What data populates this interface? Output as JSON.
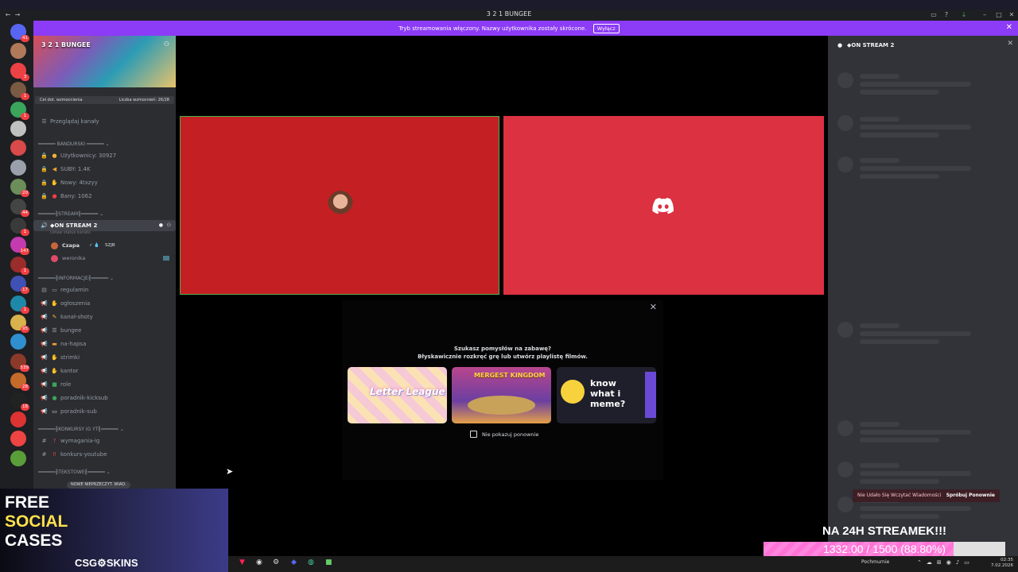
{
  "window": {
    "title": "3 2 1 BUNGEE"
  },
  "banner": {
    "text": "Tryb streamowania włączony. Nazwy użytkownika zostały skrócone.",
    "button": "Wyłącz"
  },
  "servers": [
    {
      "badge": "41",
      "color": "#5865f2"
    },
    {
      "badge": "",
      "color": "#b07a5a"
    },
    {
      "badge": "3",
      "color": "#ed4245"
    },
    {
      "badge": "1",
      "color": "#7a5a42"
    },
    {
      "badge": "1",
      "color": "#3ba55c"
    },
    {
      "badge": "",
      "color": "#c0c0c0"
    },
    {
      "badge": "",
      "color": "#d94a4a"
    },
    {
      "badge": "",
      "color": "#9aa1ad"
    },
    {
      "badge": "20",
      "color": "#6b8e5a"
    },
    {
      "badge": "44",
      "color": "#444"
    },
    {
      "badge": "1",
      "color": "#3a3a3a"
    },
    {
      "badge": "147",
      "color": "#c43bb0"
    },
    {
      "badge": "1",
      "color": "#9b2c2c"
    },
    {
      "badge": "17",
      "color": "#3f51b5"
    },
    {
      "badge": "1",
      "color": "#1e88a8"
    },
    {
      "badge": "95",
      "color": "#d8b24a"
    },
    {
      "badge": "",
      "color": "#2f8fcf"
    },
    {
      "badge": "539",
      "color": "#8b3a2a"
    },
    {
      "badge": "28",
      "color": "#c46a2a"
    },
    {
      "badge": "18",
      "color": "#222"
    },
    {
      "badge": "",
      "color": "#d33"
    },
    {
      "badge": "",
      "color": "#e44"
    },
    {
      "badge": "",
      "color": "#5a9e3a"
    }
  ],
  "guild": {
    "name": "3 2 1 BUNGEE",
    "boost_goal": "Cel dot. wzmocnienia",
    "boost_count": "Liczba wzmocnień: 26/28",
    "browse": "Przeglądaj kanały"
  },
  "sidebar": {
    "cat_bandurski": "BANDURSKI",
    "stat_users": "Użytkownicy: 30927",
    "stat_subs": "SUBY: 1.4K",
    "stat_new": "Nowy: 4txzyy",
    "stat_bans": "Bany: 1062",
    "cat_stream": "STREAM",
    "voice_channel": "◆ON STREAM 2",
    "voice_status": "Ustaw status kanału",
    "user1": "Czapa",
    "user1_tag": "SZJB",
    "user2": "weronika",
    "cat_info": "INFORMACJE",
    "ch_regulamin": "regulamin",
    "ch_ogloszenia": "ogłoszenia",
    "ch_kanal_shoty": "kanał-shoty",
    "ch_bungee": "bungee",
    "ch_na_hapsa": "na-hapsa",
    "ch_strimki": "strimki",
    "ch_kantor": "kantor",
    "ch_role": "role",
    "ch_poradnik_kicksub": "poradnik-kicksub",
    "ch_poradnik_sub": "poradnik-sub",
    "cat_konkursy": "KONKURSY IG YT",
    "ch_wymagania": "wymagania-ig",
    "ch_konkurs_youtube": "konkurs-youtube",
    "cat_tekstowe": "TEKSTOWE",
    "new_unread": "NOWE NIEPRZECZYT. WIAD."
  },
  "popup": {
    "title1": "Szukasz pomysłów na zabawę?",
    "title2": "Błyskawicznie rozkręć grę lub utwórz playlistę filmów.",
    "card1": "Letter League",
    "card2": "MERGEST KINGDOM",
    "card3": "know what i meme?",
    "checkbox": "Nie pokazuj ponownie"
  },
  "chat": {
    "header": "◆ON STREAM 2",
    "error": "Nie Udało Się Wczytać Wiadomości",
    "retry": "Spróbuj Ponownie"
  },
  "overlay": {
    "ad_line1": "FREE",
    "ad_line2": "SOCIAL",
    "ad_line3": "CASES",
    "ad_brand": "CSG⚙SKINS",
    "goal_title": "NA 24H STREAMEK!!!",
    "goal_text": "1332.00 / 1500 (88.80%)",
    "goal_fraction": 0.888
  },
  "taskbar": {
    "weather": "Pochmurnie",
    "time": "02:35",
    "date": "7.02.2026"
  },
  "colors": {
    "accent": "#8c3bf6",
    "tile_red": "#c41f22",
    "discord_red": "#dc3141",
    "goal_pink": "#ff73d6"
  }
}
